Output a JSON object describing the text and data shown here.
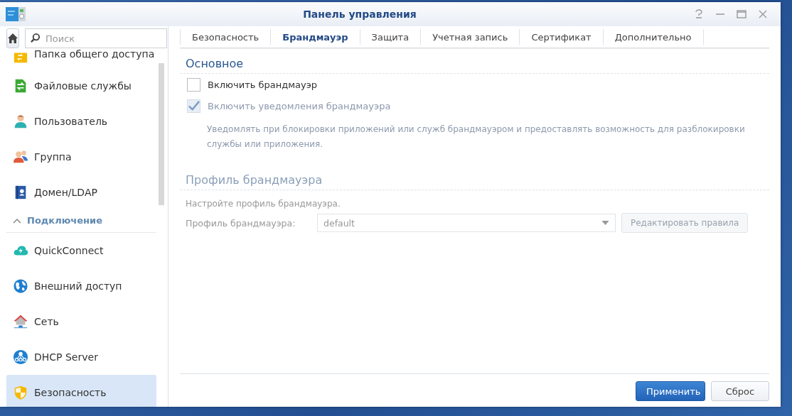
{
  "window": {
    "title": "Панель управления"
  },
  "sidebar": {
    "search": {
      "placeholder": "Поиск"
    },
    "items": [
      {
        "kind": "item",
        "label": "Папка общего доступа",
        "selected": false
      },
      {
        "kind": "item",
        "label": "Файловые службы",
        "selected": false
      },
      {
        "kind": "item",
        "label": "Пользователь",
        "selected": false
      },
      {
        "kind": "item",
        "label": "Группа",
        "selected": false
      },
      {
        "kind": "item",
        "label": "Домен/LDAP",
        "selected": false
      },
      {
        "kind": "section",
        "label": "Подключение",
        "expanded": true
      },
      {
        "kind": "item",
        "label": "QuickConnect",
        "selected": false
      },
      {
        "kind": "item",
        "label": "Внешний доступ",
        "selected": false
      },
      {
        "kind": "item",
        "label": "Сеть",
        "selected": false
      },
      {
        "kind": "item",
        "label": "DHCP Server",
        "selected": false
      },
      {
        "kind": "item",
        "label": "Безопасность",
        "selected": true
      }
    ]
  },
  "tabs": [
    {
      "label": "Безопасность",
      "selected": false
    },
    {
      "label": "Брандмауэр",
      "selected": true
    },
    {
      "label": "Защита",
      "selected": false
    },
    {
      "label": "Учетная запись",
      "selected": false
    },
    {
      "label": "Сертификат",
      "selected": false
    },
    {
      "label": "Дополнительно",
      "selected": false
    }
  ],
  "basic": {
    "title": "Основное",
    "options": [
      {
        "label": "Включить брандмауэр",
        "checked": false,
        "disabled": false
      },
      {
        "label": "Включить уведомления брандмауэра",
        "checked": true,
        "disabled": true
      }
    ],
    "description": "Уведомлять при блокировки приложений или служб брандмауэром и предоставлять возможность для разблокировки службы или приложения."
  },
  "profile": {
    "title": "Профиль брандмауэра",
    "disabled": true,
    "hint": "Настройте профиль брандмауэра.",
    "field_label": "Профиль брандмауэра:",
    "value": "default",
    "edit_button": "Редактировать правила"
  },
  "buttons": [
    {
      "label": "Применить",
      "kind": "primary"
    },
    {
      "label": "Сброс",
      "kind": "secondary"
    }
  ]
}
